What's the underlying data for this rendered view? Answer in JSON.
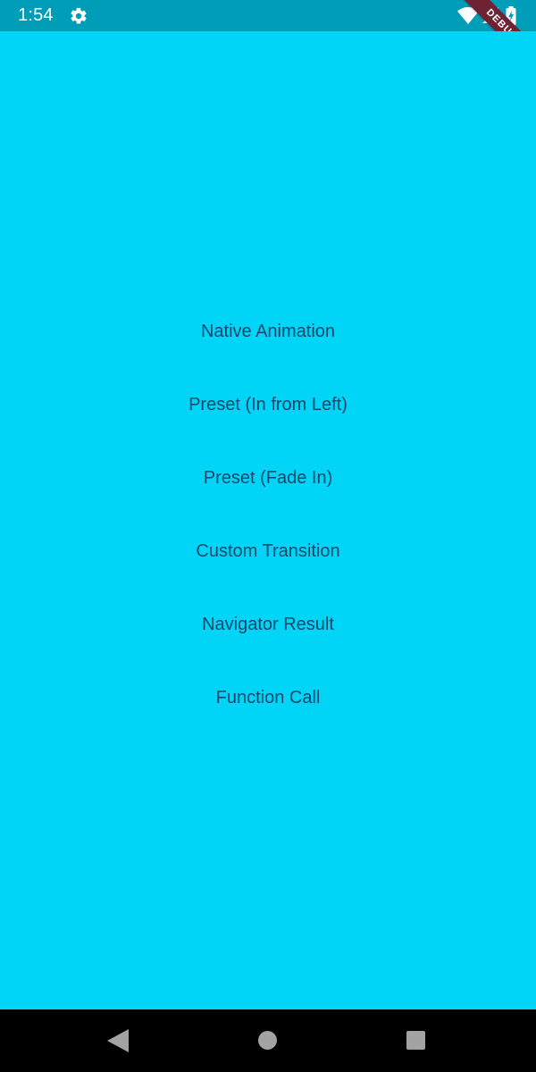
{
  "status_bar": {
    "time": "1:54",
    "icons": [
      "settings-icon",
      "wifi-icon",
      "signal-icon",
      "battery-icon"
    ]
  },
  "debug_banner": {
    "label": "DEBUG"
  },
  "menu": {
    "items": [
      {
        "label": "Native Animation"
      },
      {
        "label": "Preset (In from Left)"
      },
      {
        "label": "Preset (Fade In)"
      },
      {
        "label": "Custom Transition"
      },
      {
        "label": "Navigator Result"
      },
      {
        "label": "Function Call"
      }
    ]
  },
  "nav_bar": {
    "icons": [
      "back-icon",
      "home-icon",
      "recents-icon"
    ]
  },
  "colors": {
    "background": "#00d4f7",
    "status_bar": "#009db8",
    "button_text": "#12486a",
    "debug_ribbon": "#6f2234",
    "nav_bar": "#000000"
  }
}
